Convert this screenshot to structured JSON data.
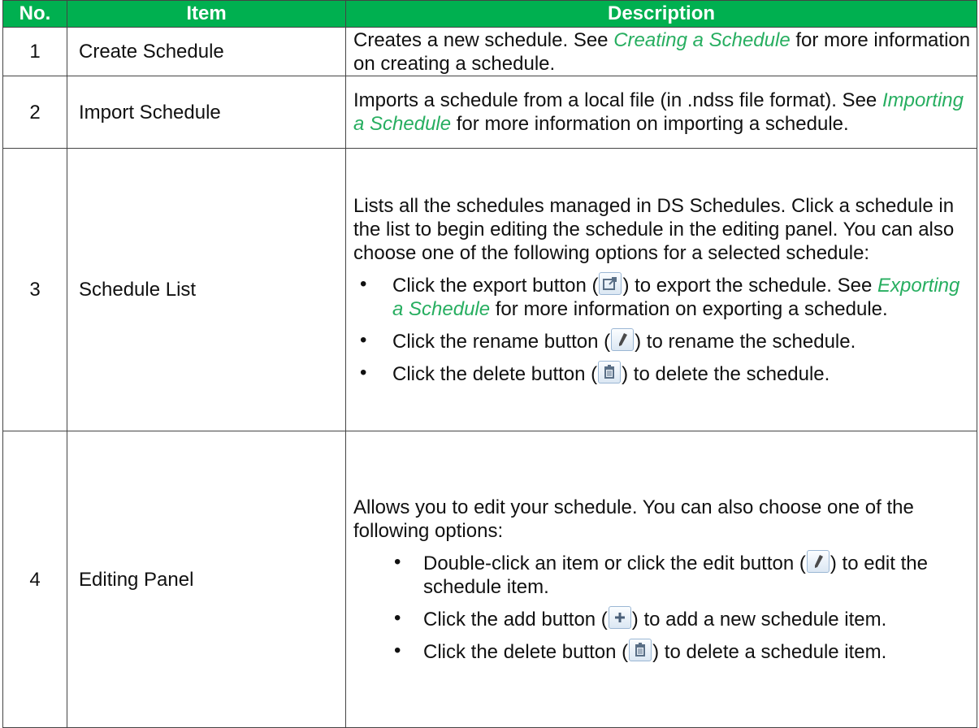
{
  "headers": {
    "no": "No.",
    "item": "Item",
    "description": "Description"
  },
  "rows": [
    {
      "no": "1",
      "item": "Create Schedule",
      "desc_a": "Creates a new schedule. See ",
      "desc_ref": "Creating a Schedule",
      "desc_b": " for more information on creating a schedule."
    },
    {
      "no": "2",
      "item": "Import Schedule",
      "desc_a": "Imports a schedule from a local file (in .ndss file format). See ",
      "desc_ref": "Importing a Schedule",
      "desc_b": " for more information on importing a schedule."
    },
    {
      "no": "3",
      "item": "Schedule List",
      "intro": "Lists all the schedules managed in DS Schedules. Click a schedule in the list to begin editing the schedule in the editing panel. You can also choose one of the following options for a selected schedule:",
      "bullets": [
        {
          "a": "Click the export button (",
          "icon": "export-icon",
          "b": ") to export the schedule. See ",
          "ref": "Exporting a Schedule",
          "c": " for more information on exporting a schedule."
        },
        {
          "a": "Click the rename button (",
          "icon": "rename-icon",
          "b": ") to rename the schedule."
        },
        {
          "a": "Click the delete button (",
          "icon": "delete-icon",
          "b": ") to delete the schedule."
        }
      ]
    },
    {
      "no": "4",
      "item": "Editing Panel",
      "intro": "Allows you to edit your schedule. You can also choose one of the following options:",
      "bullets": [
        {
          "a": "Double-click an item or click the edit button (",
          "icon": "edit-icon",
          "b": ") to edit the schedule item."
        },
        {
          "a": "Click the add button (",
          "icon": "add-icon",
          "b": ") to add a new schedule item."
        },
        {
          "a": "Click the delete button (",
          "icon": "delete-icon",
          "b": ") to delete a schedule item."
        }
      ]
    }
  ],
  "colors": {
    "header_bg": "#00b050",
    "link": "#27ae60"
  }
}
